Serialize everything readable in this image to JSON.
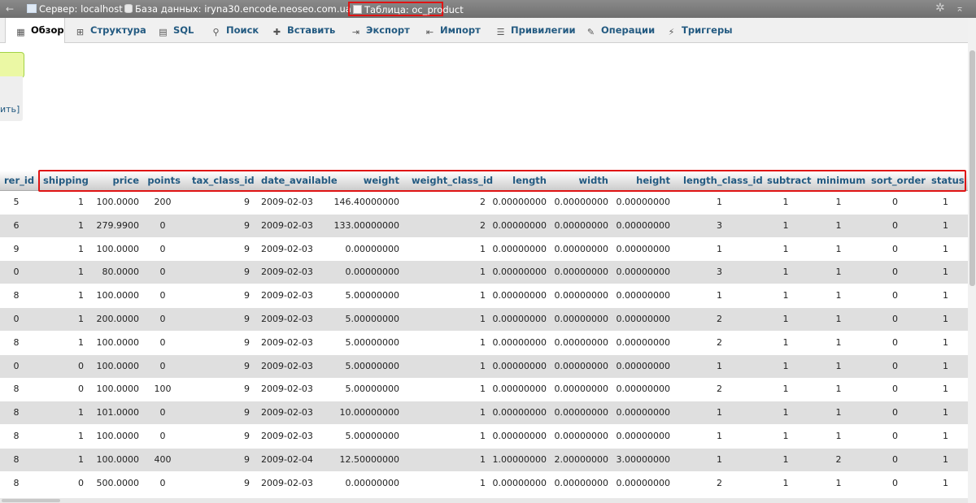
{
  "breadcrumb": {
    "back": "←",
    "server": "Сервер: localhost »",
    "database": "База данных: iryna30.encode.neoseo.com.ua »",
    "table": "Таблица: oc_product"
  },
  "tabs": [
    {
      "label": "Обзор",
      "icon": "browse-icon",
      "glyph": "▦"
    },
    {
      "label": "Структура",
      "icon": "structure-icon",
      "glyph": "⊞"
    },
    {
      "label": "SQL",
      "icon": "sql-icon",
      "glyph": "▤"
    },
    {
      "label": "Поиск",
      "icon": "search-icon",
      "glyph": "⚲"
    },
    {
      "label": "Вставить",
      "icon": "insert-icon",
      "glyph": "✚"
    },
    {
      "label": "Экспорт",
      "icon": "export-icon",
      "glyph": "⇥"
    },
    {
      "label": "Импорт",
      "icon": "import-icon",
      "glyph": "⇤"
    },
    {
      "label": "Привилегии",
      "icon": "privileges-icon",
      "glyph": "☰"
    },
    {
      "label": "Операции",
      "icon": "operations-icon",
      "glyph": "✎"
    },
    {
      "label": "Триггеры",
      "icon": "triggers-icon",
      "glyph": "⚡"
    }
  ],
  "left_panel": {
    "truncated_link": "ить]"
  },
  "table": {
    "columns": [
      "rer_id",
      "shipping",
      "price",
      "points",
      "tax_class_id",
      "date_available",
      "weight",
      "weight_class_id",
      "length",
      "width",
      "height",
      "length_class_id",
      "subtract",
      "minimum",
      "sort_order",
      "status"
    ],
    "rows": [
      [
        "5",
        "1",
        "100.0000",
        "200",
        "9",
        "2009-02-03",
        "146.40000000",
        "2",
        "0.00000000",
        "0.00000000",
        "0.00000000",
        "1",
        "1",
        "1",
        "0",
        "1"
      ],
      [
        "6",
        "1",
        "279.9900",
        "0",
        "9",
        "2009-02-03",
        "133.00000000",
        "2",
        "0.00000000",
        "0.00000000",
        "0.00000000",
        "3",
        "1",
        "1",
        "0",
        "1"
      ],
      [
        "9",
        "1",
        "100.0000",
        "0",
        "9",
        "2009-02-03",
        "0.00000000",
        "1",
        "0.00000000",
        "0.00000000",
        "0.00000000",
        "1",
        "1",
        "1",
        "0",
        "1"
      ],
      [
        "0",
        "1",
        "80.0000",
        "0",
        "9",
        "2009-02-03",
        "0.00000000",
        "1",
        "0.00000000",
        "0.00000000",
        "0.00000000",
        "3",
        "1",
        "1",
        "0",
        "1"
      ],
      [
        "8",
        "1",
        "100.0000",
        "0",
        "9",
        "2009-02-03",
        "5.00000000",
        "1",
        "0.00000000",
        "0.00000000",
        "0.00000000",
        "1",
        "1",
        "1",
        "0",
        "1"
      ],
      [
        "0",
        "1",
        "200.0000",
        "0",
        "9",
        "2009-02-03",
        "5.00000000",
        "1",
        "0.00000000",
        "0.00000000",
        "0.00000000",
        "2",
        "1",
        "1",
        "0",
        "1"
      ],
      [
        "8",
        "1",
        "100.0000",
        "0",
        "9",
        "2009-02-03",
        "5.00000000",
        "1",
        "0.00000000",
        "0.00000000",
        "0.00000000",
        "2",
        "1",
        "1",
        "0",
        "1"
      ],
      [
        "0",
        "0",
        "100.0000",
        "0",
        "9",
        "2009-02-03",
        "5.00000000",
        "1",
        "0.00000000",
        "0.00000000",
        "0.00000000",
        "1",
        "1",
        "1",
        "0",
        "1"
      ],
      [
        "8",
        "0",
        "100.0000",
        "100",
        "9",
        "2009-02-03",
        "5.00000000",
        "1",
        "0.00000000",
        "0.00000000",
        "0.00000000",
        "2",
        "1",
        "1",
        "0",
        "1"
      ],
      [
        "8",
        "1",
        "101.0000",
        "0",
        "9",
        "2009-02-03",
        "10.00000000",
        "1",
        "0.00000000",
        "0.00000000",
        "0.00000000",
        "1",
        "1",
        "1",
        "0",
        "1"
      ],
      [
        "8",
        "1",
        "100.0000",
        "0",
        "9",
        "2009-02-03",
        "5.00000000",
        "1",
        "0.00000000",
        "0.00000000",
        "0.00000000",
        "1",
        "1",
        "1",
        "0",
        "1"
      ],
      [
        "8",
        "1",
        "100.0000",
        "400",
        "9",
        "2009-02-04",
        "12.50000000",
        "1",
        "1.00000000",
        "2.00000000",
        "3.00000000",
        "1",
        "1",
        "2",
        "0",
        "1"
      ],
      [
        "8",
        "0",
        "500.0000",
        "0",
        "9",
        "2009-02-03",
        "0.00000000",
        "1",
        "0.00000000",
        "0.00000000",
        "0.00000000",
        "2",
        "1",
        "1",
        "0",
        "1"
      ]
    ]
  },
  "colors": {
    "link": "#235a81",
    "highlight_box": "#e01414",
    "row_alt": "#dfdfdf"
  }
}
